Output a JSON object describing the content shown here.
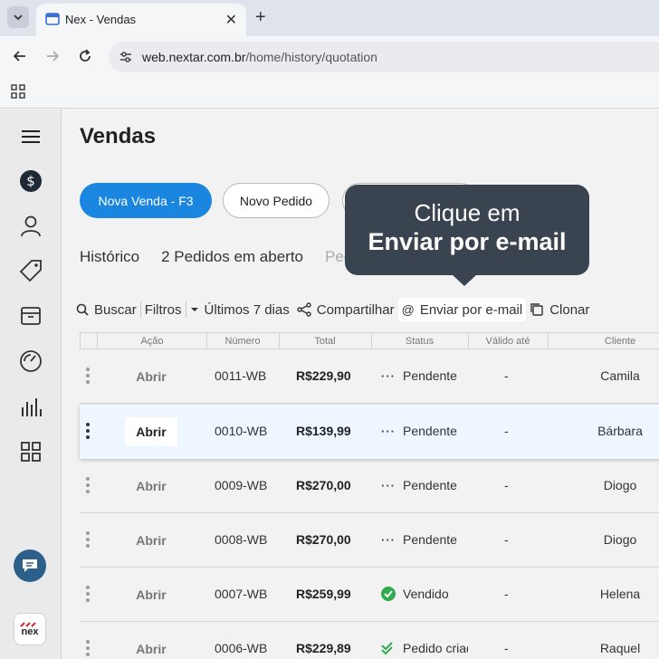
{
  "browser": {
    "tab_title": "Nex - Vendas",
    "url_host": "web.nextar.com.br",
    "url_path": "/home/history/quotation"
  },
  "page": {
    "title": "Vendas",
    "primary_button": "Nova Venda - F3",
    "secondary_button": "Novo Pedido"
  },
  "tabs": {
    "historico": "Histórico",
    "pedidos": "2 Pedidos em aberto",
    "faded": "Ped"
  },
  "tooltip": {
    "line1": "Clique em",
    "line2": "Enviar por e-mail"
  },
  "actions": {
    "buscar": "Buscar",
    "filtros": "Filtros",
    "periodo": "Últimos 7 dias",
    "compartilhar": "Compartilhar",
    "enviar": "Enviar por e-mail",
    "clonar": "Clonar"
  },
  "table": {
    "headers": {
      "acao": "Ação",
      "numero": "Número",
      "total": "Total",
      "status": "Status",
      "valido": "Válido até",
      "cliente": "Cliente"
    },
    "rows": [
      {
        "action": "Abrir",
        "number": "0011-WB",
        "total": "R$229,90",
        "status": "Pendente",
        "valid": "-",
        "client": "Camila"
      },
      {
        "action": "Abrir",
        "number": "0010-WB",
        "total": "R$139,99",
        "status": "Pendente",
        "valid": "-",
        "client": "Bárbara"
      },
      {
        "action": "Abrir",
        "number": "0009-WB",
        "total": "R$270,00",
        "status": "Pendente",
        "valid": "-",
        "client": "Diogo"
      },
      {
        "action": "Abrir",
        "number": "0008-WB",
        "total": "R$270,00",
        "status": "Pendente",
        "valid": "-",
        "client": "Diogo"
      },
      {
        "action": "Abrir",
        "number": "0007-WB",
        "total": "R$259,99",
        "status": "Vendido",
        "valid": "-",
        "client": "Helena"
      },
      {
        "action": "Abrir",
        "number": "0006-WB",
        "total": "R$229,89",
        "status": "Pedido criad",
        "valid": "-",
        "client": "Raquel"
      }
    ]
  },
  "sidebar": {
    "logo_text": "nex"
  },
  "colors": {
    "primary": "#1a86e0",
    "tooltip": "#3a4350",
    "success": "#2eaa4f",
    "selected_row": "#eef7ff"
  }
}
